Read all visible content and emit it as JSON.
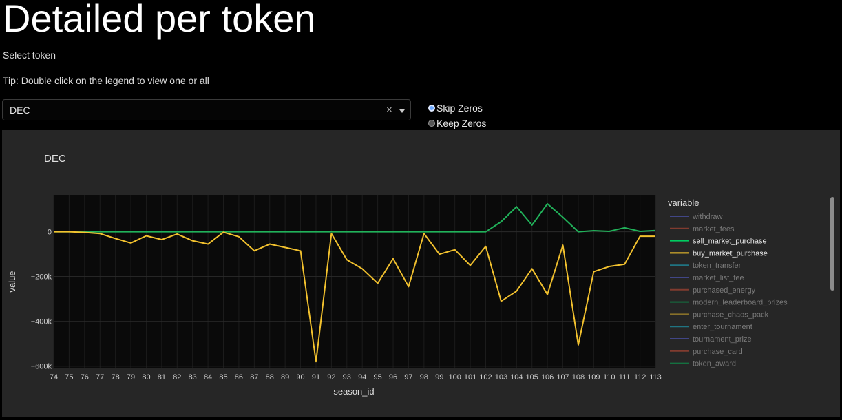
{
  "header": {
    "title": "Detailed per token",
    "select_label": "Select token",
    "tip": "Tip: Double click on the legend to view one or all"
  },
  "token_select": {
    "value": "DEC",
    "clear_glyph": "×"
  },
  "zero_options": {
    "options": [
      "Skip Zeros",
      "Keep Zeros"
    ],
    "selected": "Skip Zeros"
  },
  "chart_data": {
    "type": "line",
    "title": "DEC",
    "xlabel": "season_id",
    "ylabel": "value",
    "x": [
      74,
      75,
      76,
      77,
      78,
      79,
      80,
      81,
      82,
      83,
      84,
      85,
      86,
      87,
      88,
      89,
      90,
      91,
      92,
      93,
      94,
      95,
      96,
      97,
      98,
      99,
      100,
      101,
      102,
      103,
      104,
      105,
      106,
      107,
      108,
      109,
      110,
      111,
      112,
      113
    ],
    "ylim": [
      -610000,
      165000
    ],
    "yticks": [
      0,
      -200000,
      -400000,
      -600000
    ],
    "ytick_labels": [
      "0",
      "−200k",
      "−400k",
      "−600k"
    ],
    "grid": true,
    "legend_title": "variable",
    "legend": [
      {
        "name": "withdraw",
        "color": "#636efa",
        "active": false
      },
      {
        "name": "market_fees",
        "color": "#ef553b",
        "active": false
      },
      {
        "name": "sell_market_purchase",
        "color": "#00cc60",
        "active": true
      },
      {
        "name": "buy_market_purchase",
        "color": "#fecb2e",
        "active": true
      },
      {
        "name": "token_transfer",
        "color": "#19d3f3",
        "active": false
      },
      {
        "name": "market_list_fee",
        "color": "#636efa",
        "active": false
      },
      {
        "name": "purchased_energy",
        "color": "#ef553b",
        "active": false
      },
      {
        "name": "modern_leaderboard_prizes",
        "color": "#00cc60",
        "active": false
      },
      {
        "name": "purchase_chaos_pack",
        "color": "#fecb2e",
        "active": false
      },
      {
        "name": "enter_tournament",
        "color": "#19d3f3",
        "active": false
      },
      {
        "name": "tournament_prize",
        "color": "#636efa",
        "active": false
      },
      {
        "name": "purchase_card",
        "color": "#ef553b",
        "active": false
      },
      {
        "name": "token_award",
        "color": "#00cc60",
        "active": false
      }
    ],
    "series": [
      {
        "name": "sell_market_purchase",
        "color": "#21b25a",
        "values": [
          0,
          0,
          0,
          0,
          0,
          0,
          0,
          0,
          0,
          0,
          0,
          0,
          0,
          0,
          0,
          0,
          0,
          0,
          0,
          0,
          0,
          0,
          0,
          0,
          0,
          0,
          0,
          0,
          0,
          45000,
          112000,
          30000,
          125000,
          65000,
          0,
          5000,
          2000,
          18000,
          2000,
          6000
        ]
      },
      {
        "name": "buy_market_purchase",
        "color": "#f2c12e",
        "values": [
          0,
          0,
          -3000,
          -8000,
          -30000,
          -50000,
          -18000,
          -35000,
          -10000,
          -40000,
          -55000,
          -2000,
          -22000,
          -85000,
          -55000,
          -70000,
          -85000,
          -580000,
          -8000,
          -125000,
          -165000,
          -230000,
          -120000,
          -245000,
          -8000,
          -100000,
          -80000,
          -150000,
          -65000,
          -310000,
          -265000,
          -165000,
          -280000,
          -60000,
          -505000,
          -178000,
          -155000,
          -145000,
          -20000,
          -20000
        ]
      }
    ]
  }
}
